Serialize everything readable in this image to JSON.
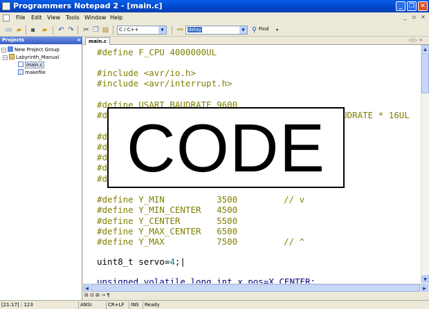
{
  "window": {
    "title": "Programmers Notepad 2 - [main.c]",
    "minimize": "_",
    "restore": "❐",
    "close": "✕"
  },
  "menu": {
    "items": [
      "File",
      "Edit",
      "View",
      "Tools",
      "Window",
      "Help"
    ],
    "mdi_minimize": "_",
    "mdi_restore": "▫",
    "mdi_close": "×"
  },
  "toolbar": {
    "scheme_value": "C / C++",
    "search_value": "delay",
    "find_label": "Find"
  },
  "projects": {
    "header": "Projects",
    "close": "×",
    "items": [
      {
        "label": "New Project Group"
      },
      {
        "label": "Labyrinth_Manual"
      },
      {
        "label": "main.c"
      },
      {
        "label": "makefile"
      }
    ]
  },
  "tabs": {
    "active": "main.c",
    "nav": "◁ ▷ ×"
  },
  "editor": {
    "lines": [
      "#define F_CPU 4000000UL",
      "",
      "#include <avr/io.h>",
      "#include <avr/interrupt.h>",
      "",
      "#define USART_BAUDRATE 9600",
      "#d",
      "UDRATE * 16UL",
      "#d",
      "#d",
      "#d",
      "#d",
      "#d",
      "#define Y_MIN          3500",
      "#define Y_MIN_CENTER   4500",
      "#define Y_CENTER       5500",
      "#define Y_MAX_CENTER   6500",
      "#define Y_MAX          7500",
      "uint8_t servo=",
      "4",
      ";",
      "unsigned volatile long int x_pos=X_CENTER;"
    ],
    "comments": [
      "// v",
      "// ^"
    ]
  },
  "overlay": {
    "text": "CODE"
  },
  "mini_toolbar": {
    "text": "⊞ ⊟ ⊠ → ¶"
  },
  "status": {
    "position": "[21:17] : 123",
    "encoding": "ANSI",
    "line_ending": "CR+LF",
    "mode": "INS",
    "state": "Ready"
  }
}
